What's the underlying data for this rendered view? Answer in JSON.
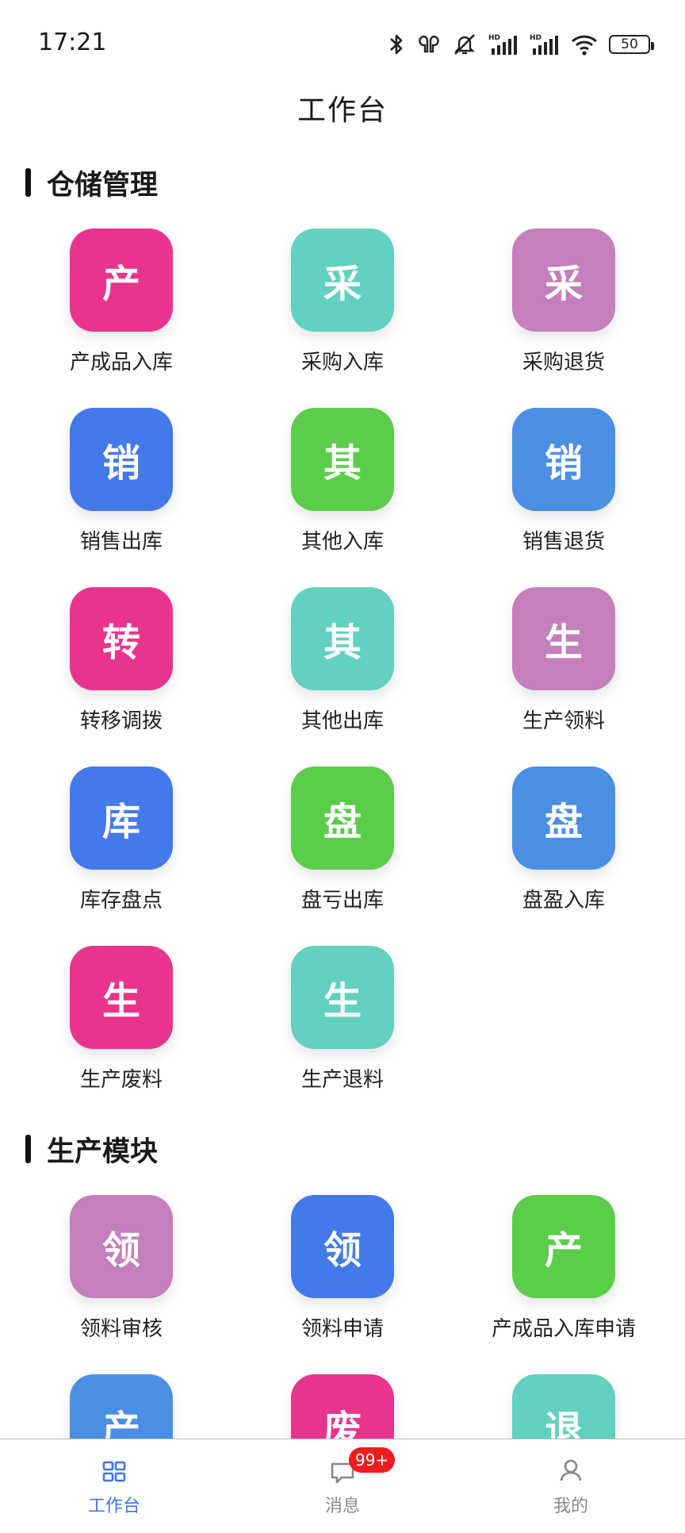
{
  "status_bar": {
    "time": "17:21",
    "battery": "50",
    "icons": [
      "bluetooth-icon",
      "earbuds-icon",
      "mute-icon",
      "signal-hd-icon",
      "signal-hd-icon",
      "wifi-icon",
      "battery-icon"
    ]
  },
  "header": {
    "title": "工作台"
  },
  "sections": [
    {
      "title": "仓储管理",
      "items": [
        {
          "glyph": "产",
          "label": "产成品入库",
          "color": "#e9348e"
        },
        {
          "glyph": "采",
          "label": "采购入库",
          "color": "#62d1bf"
        },
        {
          "glyph": "采",
          "label": "采购退货",
          "color": "#c47fbc"
        },
        {
          "glyph": "销",
          "label": "销售出库",
          "color": "#4479ea"
        },
        {
          "glyph": "其",
          "label": "其他入库",
          "color": "#5ccc4b"
        },
        {
          "glyph": "销",
          "label": "销售退货",
          "color": "#4a8fe3"
        },
        {
          "glyph": "转",
          "label": "转移调拨",
          "color": "#e9348e"
        },
        {
          "glyph": "其",
          "label": "其他出库",
          "color": "#62d1bf"
        },
        {
          "glyph": "生",
          "label": "生产领料",
          "color": "#c47fbc"
        },
        {
          "glyph": "库",
          "label": "库存盘点",
          "color": "#4479ea"
        },
        {
          "glyph": "盘",
          "label": "盘亏出库",
          "color": "#5ccc4b"
        },
        {
          "glyph": "盘",
          "label": "盘盈入库",
          "color": "#4a8fe3"
        },
        {
          "glyph": "生",
          "label": "生产废料",
          "color": "#e9348e"
        },
        {
          "glyph": "生",
          "label": "生产退料",
          "color": "#62d1bf"
        }
      ]
    },
    {
      "title": "生产模块",
      "items": [
        {
          "glyph": "领",
          "label": "领料审核",
          "color": "#c47fbc"
        },
        {
          "glyph": "领",
          "label": "领料申请",
          "color": "#4479ea"
        },
        {
          "glyph": "产",
          "label": "产成品入库申请",
          "color": "#5ccc4b"
        },
        {
          "glyph": "产",
          "label": "",
          "color": "#4a8fe3"
        },
        {
          "glyph": "废",
          "label": "",
          "color": "#e9348e"
        },
        {
          "glyph": "退",
          "label": "",
          "color": "#62d1bf"
        }
      ]
    }
  ],
  "bottom_nav": {
    "items": [
      {
        "label": "工作台",
        "icon": "grid-icon",
        "active": true
      },
      {
        "label": "消息",
        "icon": "message-icon",
        "badge": "99+"
      },
      {
        "label": "我的",
        "icon": "person-icon"
      }
    ],
    "active_color": "#3f74ea",
    "badge_color": "#ee1c1c"
  }
}
